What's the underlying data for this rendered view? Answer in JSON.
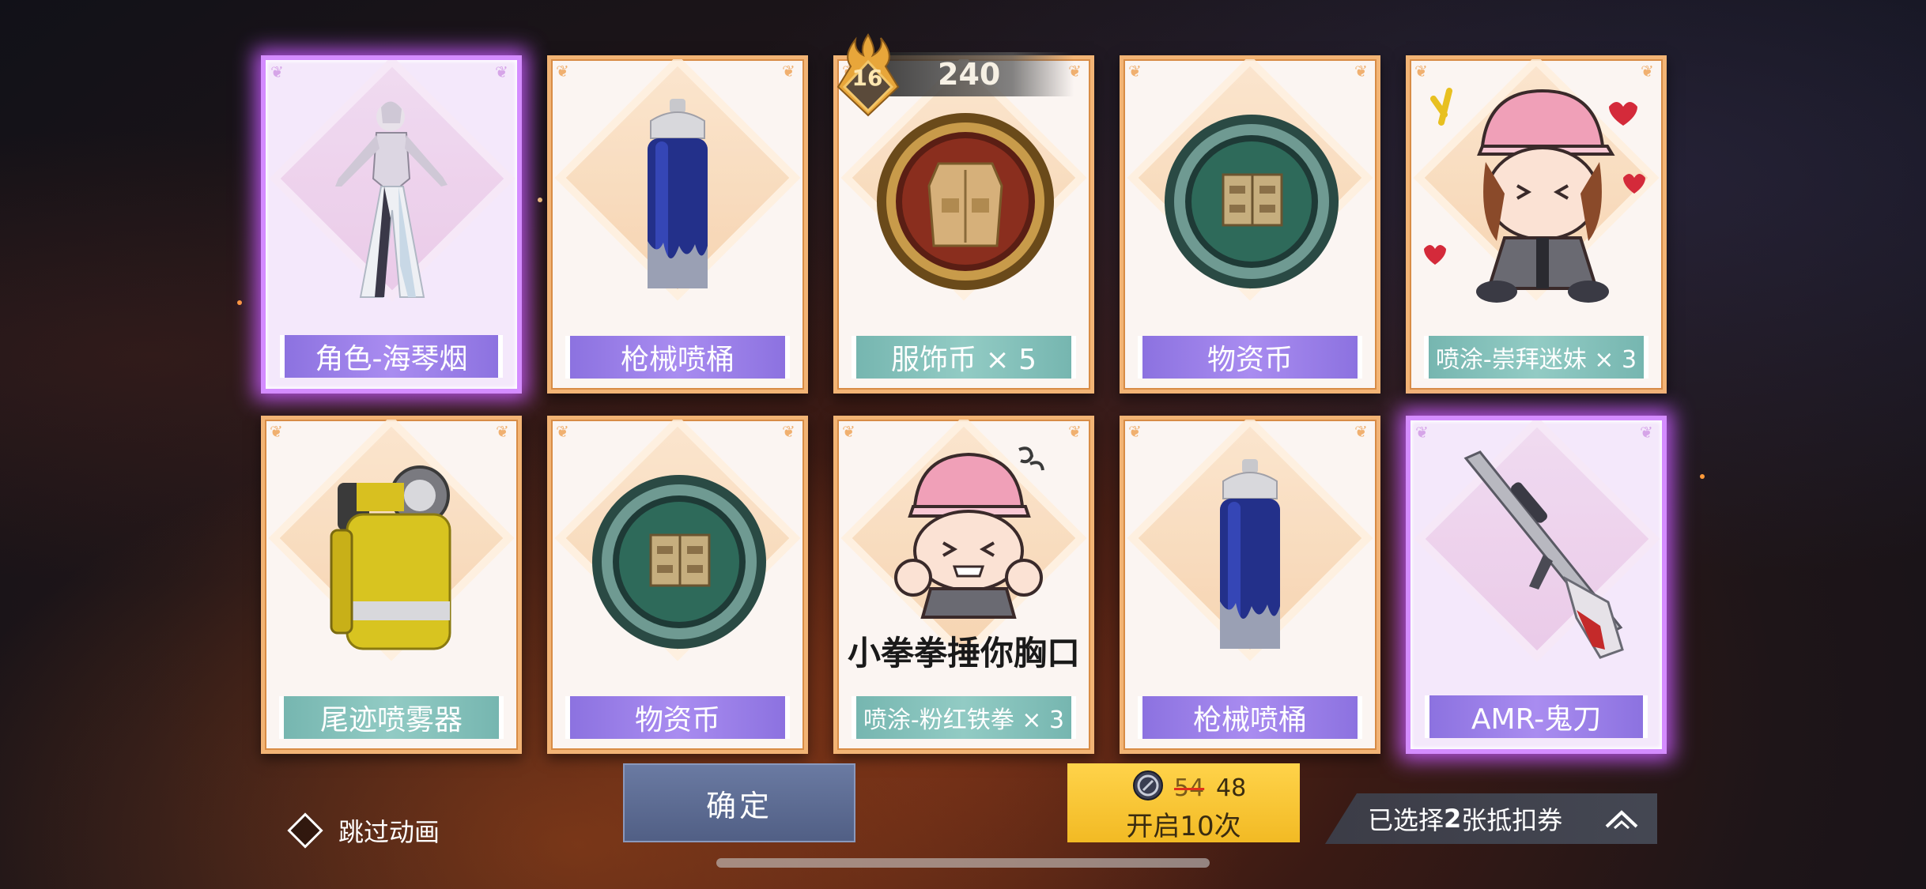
{
  "cards": [
    {
      "id": "char",
      "label": "角色-海琴烟",
      "label_style": "purple",
      "rarity": "legend",
      "art": "character-figure-icon"
    },
    {
      "id": "spray1",
      "label": "枪械喷桶",
      "label_style": "purple",
      "rarity": "normal",
      "art": "spray-can-icon"
    },
    {
      "id": "costume-coin",
      "label": "服饰币 × 5",
      "label_style": "teal",
      "rarity": "normal",
      "art": "costume-coin-icon"
    },
    {
      "id": "supply-coin1",
      "label": "物资币",
      "label_style": "purple",
      "rarity": "normal",
      "art": "equipment-coin-icon"
    },
    {
      "id": "graffiti-worship",
      "label": "喷涂-崇拜迷妹 × 3",
      "label_style": "teal",
      "rarity": "normal",
      "art": "sticker-girl-love-icon"
    },
    {
      "id": "trail-spray",
      "label": "尾迹喷雾器",
      "label_style": "teal",
      "rarity": "normal",
      "art": "trail-sprayer-icon"
    },
    {
      "id": "supply-coin2",
      "label": "物资币",
      "label_style": "purple",
      "rarity": "normal",
      "art": "equipment-coin-icon"
    },
    {
      "id": "graffiti-fist",
      "label": "喷涂-粉红铁拳 × 3",
      "label_style": "teal",
      "rarity": "normal",
      "art": "sticker-girl-fist-icon",
      "caption": "小拳拳捶你胸口"
    },
    {
      "id": "spray2",
      "label": "枪械喷桶",
      "label_style": "purple",
      "rarity": "normal",
      "art": "spray-can-icon"
    },
    {
      "id": "amr",
      "label": "AMR-鬼刀",
      "label_style": "purple",
      "rarity": "legend",
      "art": "sniper-rifle-icon"
    }
  ],
  "badge": {
    "level": "16",
    "value": "240"
  },
  "skip": {
    "label": "跳过动画"
  },
  "confirm": {
    "label": "确定"
  },
  "open": {
    "old_price": "54",
    "new_price": "48",
    "label": "开启10次",
    "icon": "coin-icon"
  },
  "selected": {
    "prefix": "已选择",
    "count": "2",
    "suffix": "张抵扣券"
  },
  "colors": {
    "legend_glow": "#d48cff",
    "card_border": "#f2b475",
    "purple_label": "#9a80e8",
    "teal_label": "#84c0ba",
    "open_button": "#f5c02c",
    "confirm_button": "#5d6b92"
  }
}
